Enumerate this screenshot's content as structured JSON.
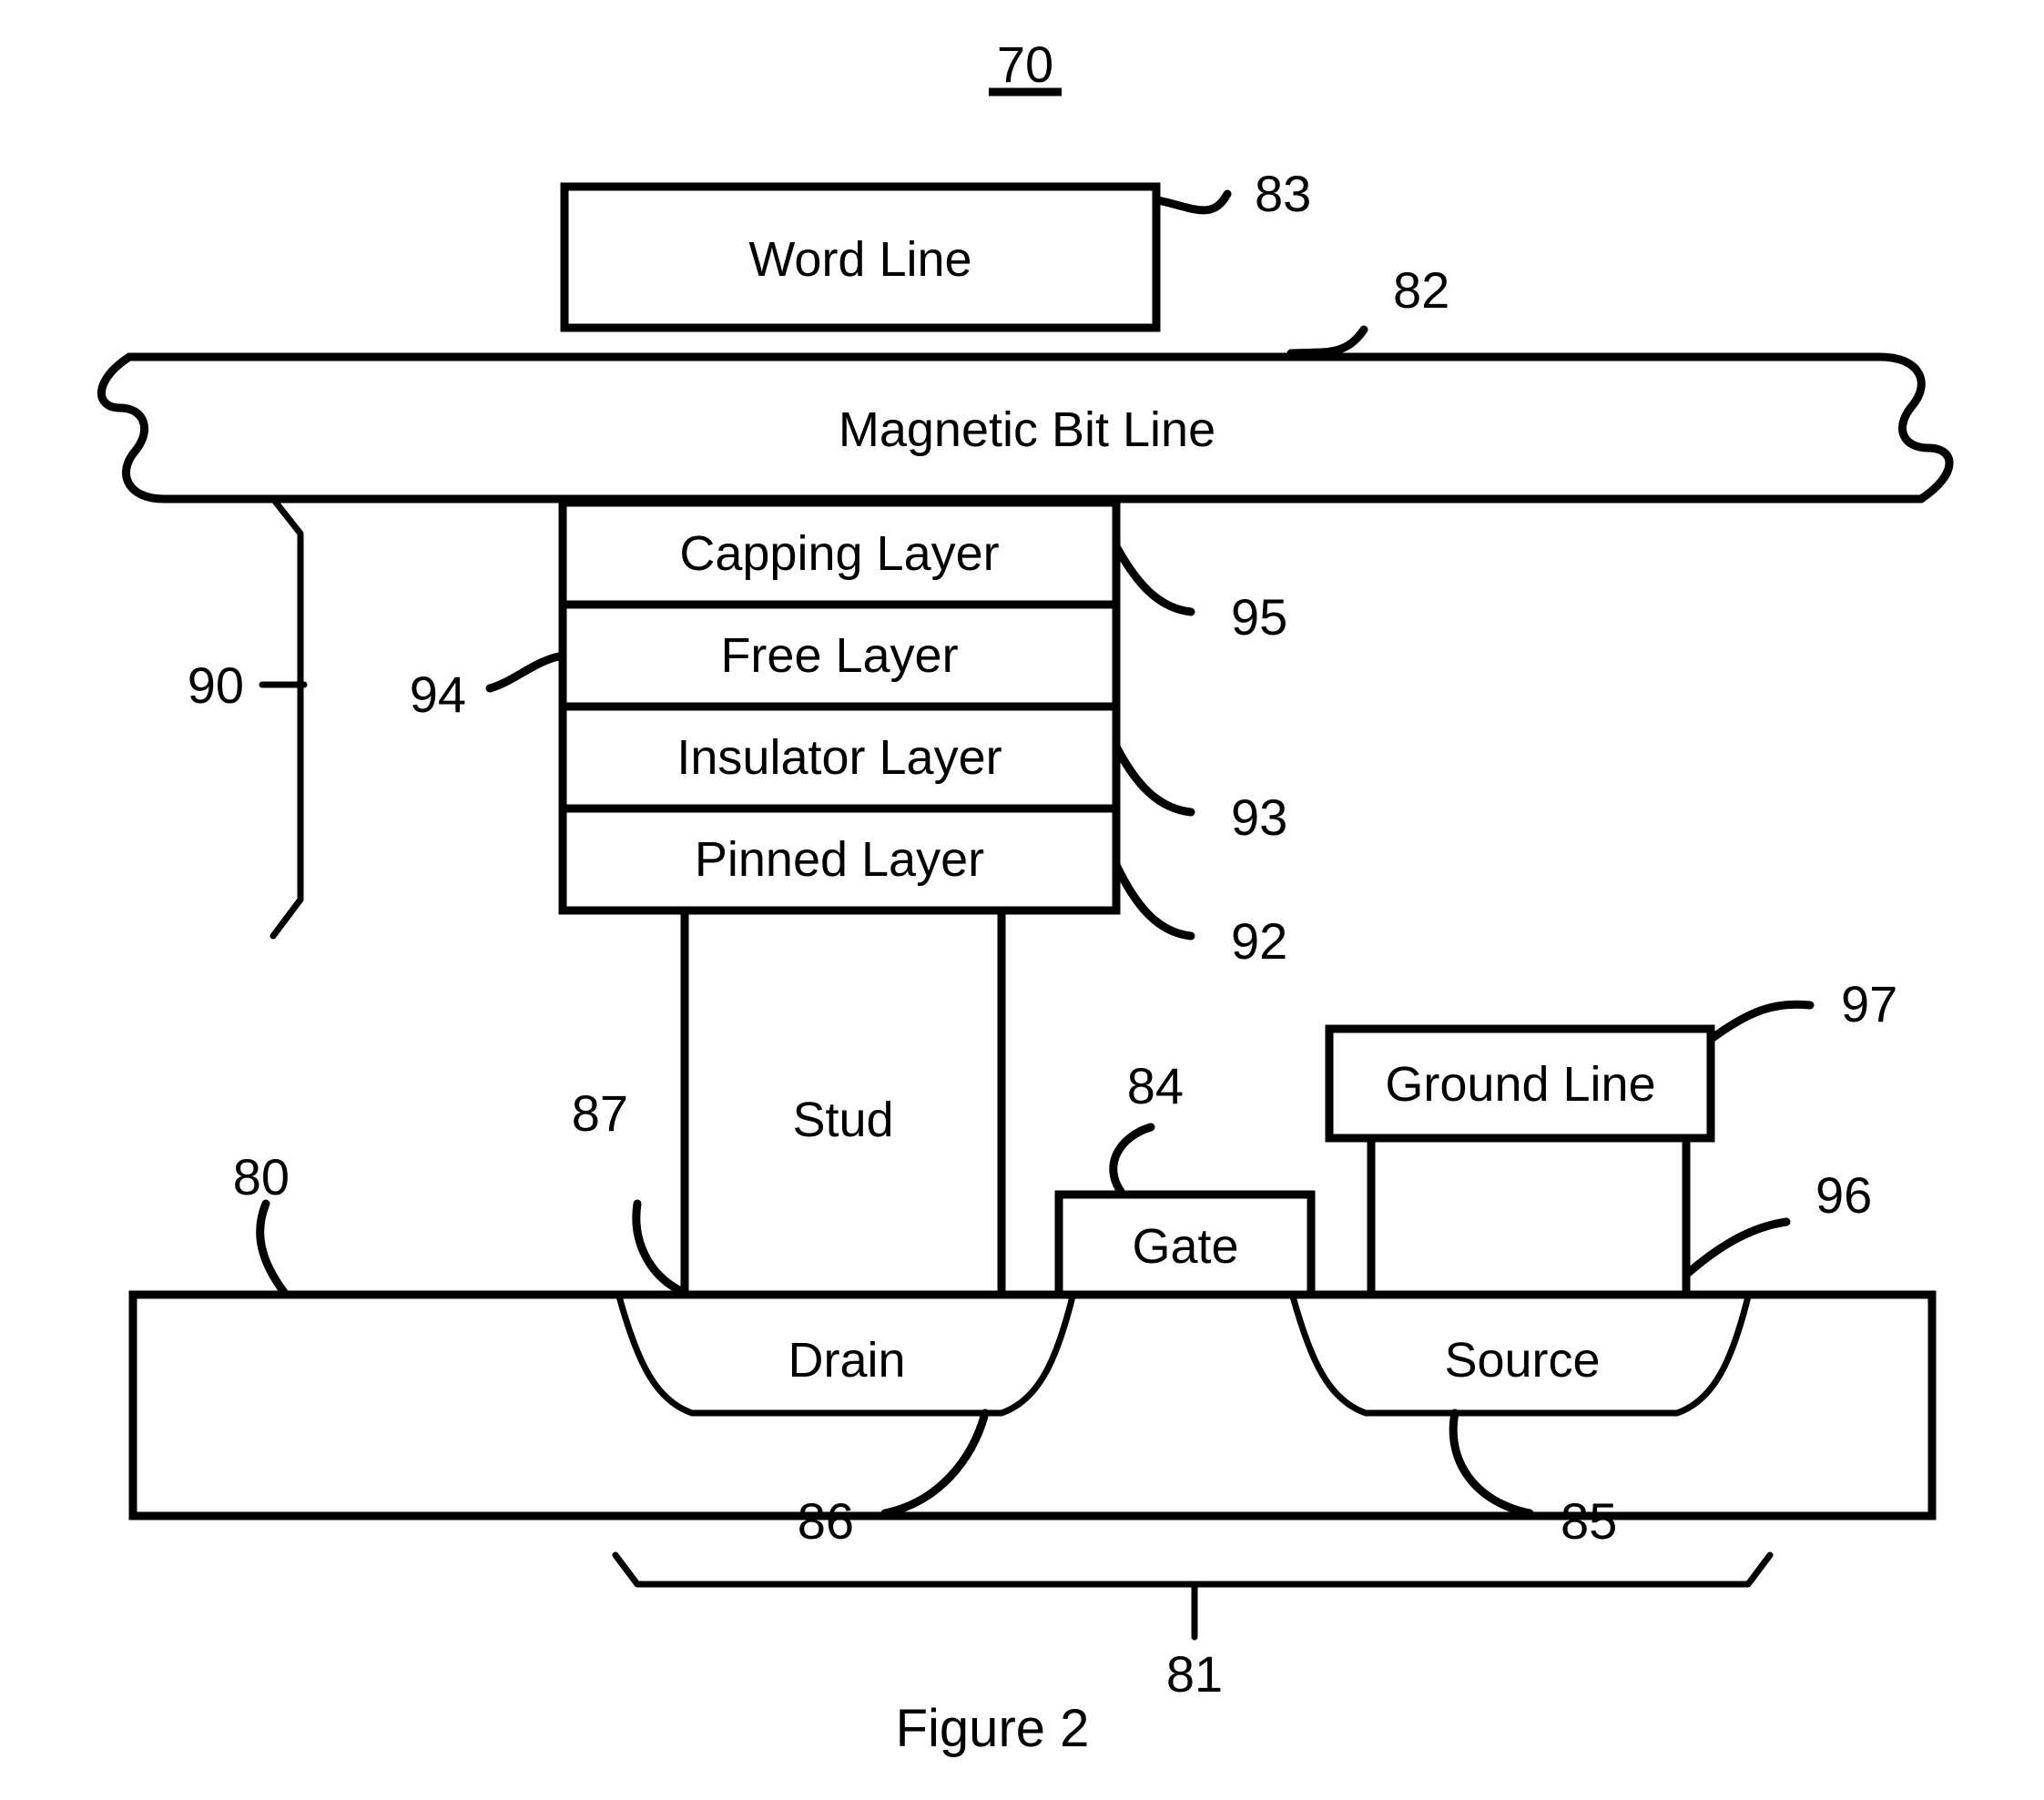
{
  "figure": {
    "number_label": "70",
    "caption": "Figure 2",
    "title_underline": true
  },
  "blocks": {
    "word_line": "Word Line",
    "magnetic_bit_line": "Magnetic Bit Line",
    "capping_layer": "Capping Layer",
    "free_layer": "Free Layer",
    "insulator_layer": "Insulator Layer",
    "pinned_layer": "Pinned Layer",
    "stud": "Stud",
    "gate": "Gate",
    "ground_line": "Ground Line",
    "drain": "Drain",
    "source": "Source"
  },
  "reference_numerals": {
    "assembly": "70",
    "substrate": "80",
    "substrate_bracket": "81",
    "bit_line": "82",
    "word_line": "83",
    "gate": "84",
    "source_region": "85",
    "drain_region": "86",
    "stud": "87",
    "mtj_bracket": "90",
    "pinned_layer": "92",
    "insulator_layer": "93",
    "mtj_stack": "94",
    "capping_layer": "95",
    "ground_via": "96",
    "ground_line": "97"
  },
  "style": {
    "ink": "#000000",
    "paper": "#ffffff"
  }
}
